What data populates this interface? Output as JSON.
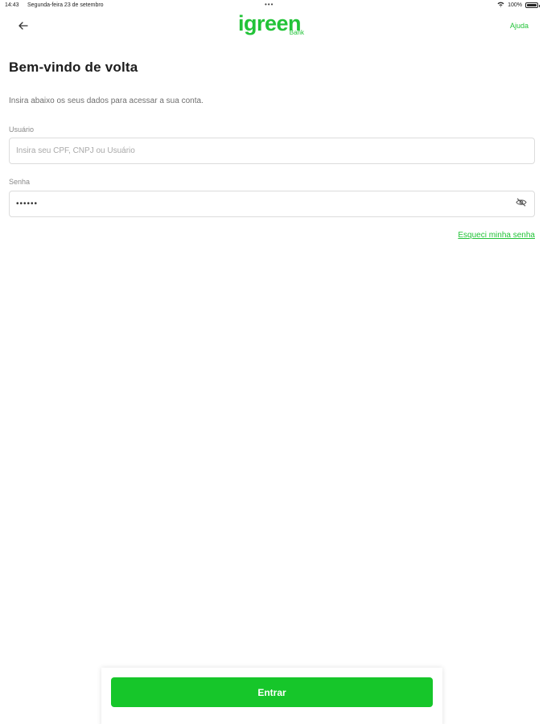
{
  "status_bar": {
    "time": "14:43",
    "date": "Segunda-feira 23 de setembro",
    "battery": "100%",
    "wifi_icon": "wifi-icon",
    "battery_icon": "battery-icon"
  },
  "nav": {
    "back_icon": "arrow-left-icon",
    "logo_text": "igreen",
    "logo_sub": "Bank",
    "help_label": "Ajuda"
  },
  "main": {
    "title": "Bem-vindo de volta",
    "subtitle": "Insira abaixo os seus dados para acessar a sua conta.",
    "user_field": {
      "label": "Usuário",
      "placeholder": "Insira seu CPF, CNPJ ou Usuário",
      "value": ""
    },
    "password_field": {
      "label": "Senha",
      "value": "••••••",
      "toggle_icon": "eye-off-icon"
    },
    "forgot_label": "Esqueci minha senha"
  },
  "footer": {
    "submit_label": "Entrar"
  },
  "colors": {
    "accent": "#22c338",
    "button": "#16c62a",
    "text": "#1c1c1c",
    "muted": "#6f6f6f",
    "border": "#dcdcdc"
  }
}
